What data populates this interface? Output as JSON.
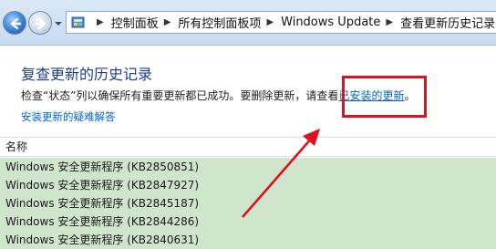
{
  "address_bar": {
    "crumbs": [
      "控制面板",
      "所有控制面板项",
      "Windows Update",
      "查看更新历史记录"
    ]
  },
  "page": {
    "title": "复查更新的历史记录",
    "description_prefix": "检查“状态”列以确保所有重要更新都已成功。要删除更新，请查看",
    "installed_link": "已安装的更新",
    "description_suffix": "。",
    "help_link": "安装更新的疑难解答"
  },
  "list": {
    "column_name": "名称",
    "rows": [
      "Windows 安全更新程序 (KB2850851)",
      "Windows 安全更新程序 (KB2847927)",
      "Windows 安全更新程序 (KB2845187)",
      "Windows 安全更新程序 (KB2844286)",
      "Windows 安全更新程序 (KB2840631)"
    ],
    "row_color": "#cfe5cc"
  },
  "annotation": {
    "color": "#e0111b"
  }
}
